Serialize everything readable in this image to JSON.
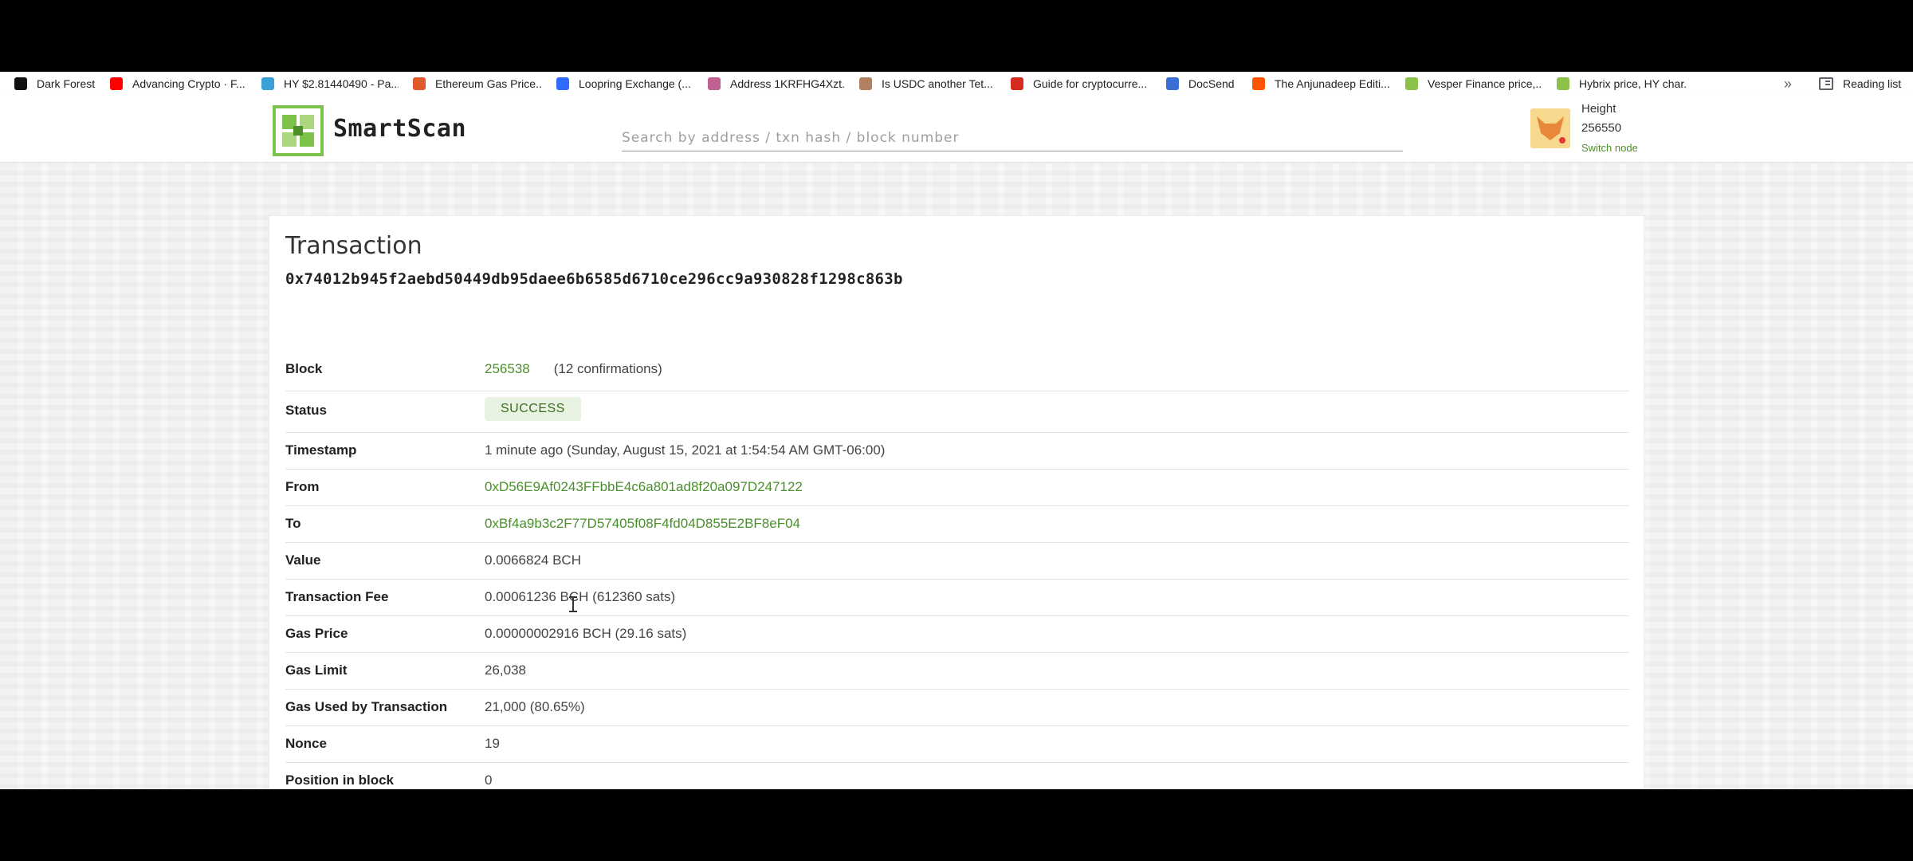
{
  "bookmarks": [
    {
      "label": "Dark Forest",
      "color": "#111111"
    },
    {
      "label": "Advancing Crypto · F...",
      "color": "#ff0000"
    },
    {
      "label": "HY $2.81440490 - Pa...",
      "color": "#3aa0d8"
    },
    {
      "label": "Ethereum Gas Price...",
      "color": "#e05a2b"
    },
    {
      "label": "Loopring Exchange (...",
      "color": "#2f6bff"
    },
    {
      "label": "Address 1KRFHG4Xzt...",
      "color": "#c06090"
    },
    {
      "label": "Is USDC another Tet...",
      "color": "#b08060"
    },
    {
      "label": "Guide for cryptocurre...",
      "color": "#d52b1e"
    },
    {
      "label": "DocSend",
      "color": "#3b6fd6"
    },
    {
      "label": "The Anjunadeep Editi...",
      "color": "#ff5500"
    },
    {
      "label": "Vesper Finance price,...",
      "color": "#8bc34a"
    },
    {
      "label": "Hybrix price, HY char...",
      "color": "#8bc34a"
    }
  ],
  "bookmarks_more": "»",
  "reading_list": "Reading list",
  "header": {
    "brand": "SmartScan",
    "search_placeholder": "Search by address / txn hash / block number",
    "height_label": "Height",
    "height_value": "256550",
    "switch_node": "Switch node"
  },
  "transaction": {
    "title": "Transaction",
    "hash": "0x74012b945f2aebd50449db95daee6b6585d6710ce296cc9a930828f1298c863b",
    "block_label": "Block",
    "block_value": "256538",
    "block_confirmations": "(12 confirmations)",
    "status_label": "Status",
    "status_value": "SUCCESS",
    "timestamp_label": "Timestamp",
    "timestamp_value": "1 minute ago  (Sunday, August 15, 2021 at 1:54:54 AM GMT-06:00)",
    "from_label": "From",
    "from_value": "0xD56E9Af0243FFbbE4c6a801ad8f20a097D247122",
    "to_label": "To",
    "to_value": "0xBf4a9b3c2F77D57405f08F4fd04D855E2BF8eF04",
    "value_label": "Value",
    "value_value": "0.0066824 BCH",
    "fee_label": "Transaction Fee",
    "fee_value": "0.00061236 BCH (612360 sats)",
    "gas_price_label": "Gas Price",
    "gas_price_value": "0.00000002916 BCH (29.16 sats)",
    "gas_limit_label": "Gas Limit",
    "gas_limit_value": "26,038",
    "gas_used_label": "Gas Used by Transaction",
    "gas_used_value": "21,000 (80.65%)",
    "nonce_label": "Nonce",
    "nonce_value": "19",
    "position_label": "Position in block",
    "position_value": "0"
  }
}
